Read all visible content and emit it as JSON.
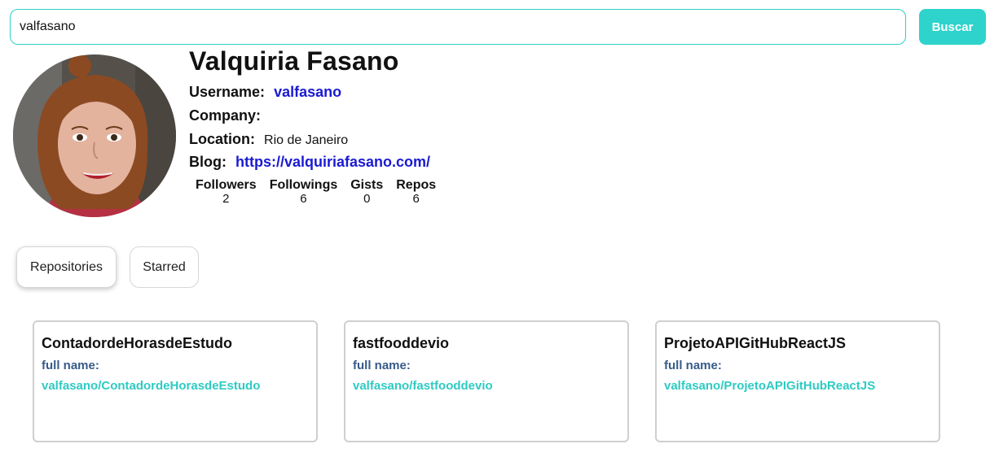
{
  "search": {
    "value": "valfasano",
    "button_label": "Buscar"
  },
  "profile": {
    "name": "Valquiria Fasano",
    "username_label": "Username:",
    "username": "valfasano",
    "company_label": "Company:",
    "company": "",
    "location_label": "Location:",
    "location": "Rio de Janeiro",
    "blog_label": "Blog:",
    "blog": "https://valquiriafasano.com/"
  },
  "stats": [
    {
      "label": "Followers",
      "value": "2"
    },
    {
      "label": "Followings",
      "value": "6"
    },
    {
      "label": "Gists",
      "value": "0"
    },
    {
      "label": "Repos",
      "value": "6"
    }
  ],
  "tabs": [
    {
      "label": "Repositories",
      "active": true
    },
    {
      "label": "Starred",
      "active": false
    }
  ],
  "repos": [
    {
      "name": "ContadordeHorasdeEstudo",
      "full_name_label": "full name:",
      "full_name": "valfasano/ContadordeHorasdeEstudo"
    },
    {
      "name": "fastfooddevio",
      "full_name_label": "full name:",
      "full_name": "valfasano/fastfooddevio"
    },
    {
      "name": "ProjetoAPIGitHubReactJS",
      "full_name_label": "full name:",
      "full_name": "valfasano/ProjetoAPIGitHubReactJS"
    }
  ],
  "colors": {
    "accent": "#2ed3cc",
    "link": "#1a1ad2",
    "full_name_label": "#375b8a",
    "full_name_value": "#2ecbc3"
  }
}
